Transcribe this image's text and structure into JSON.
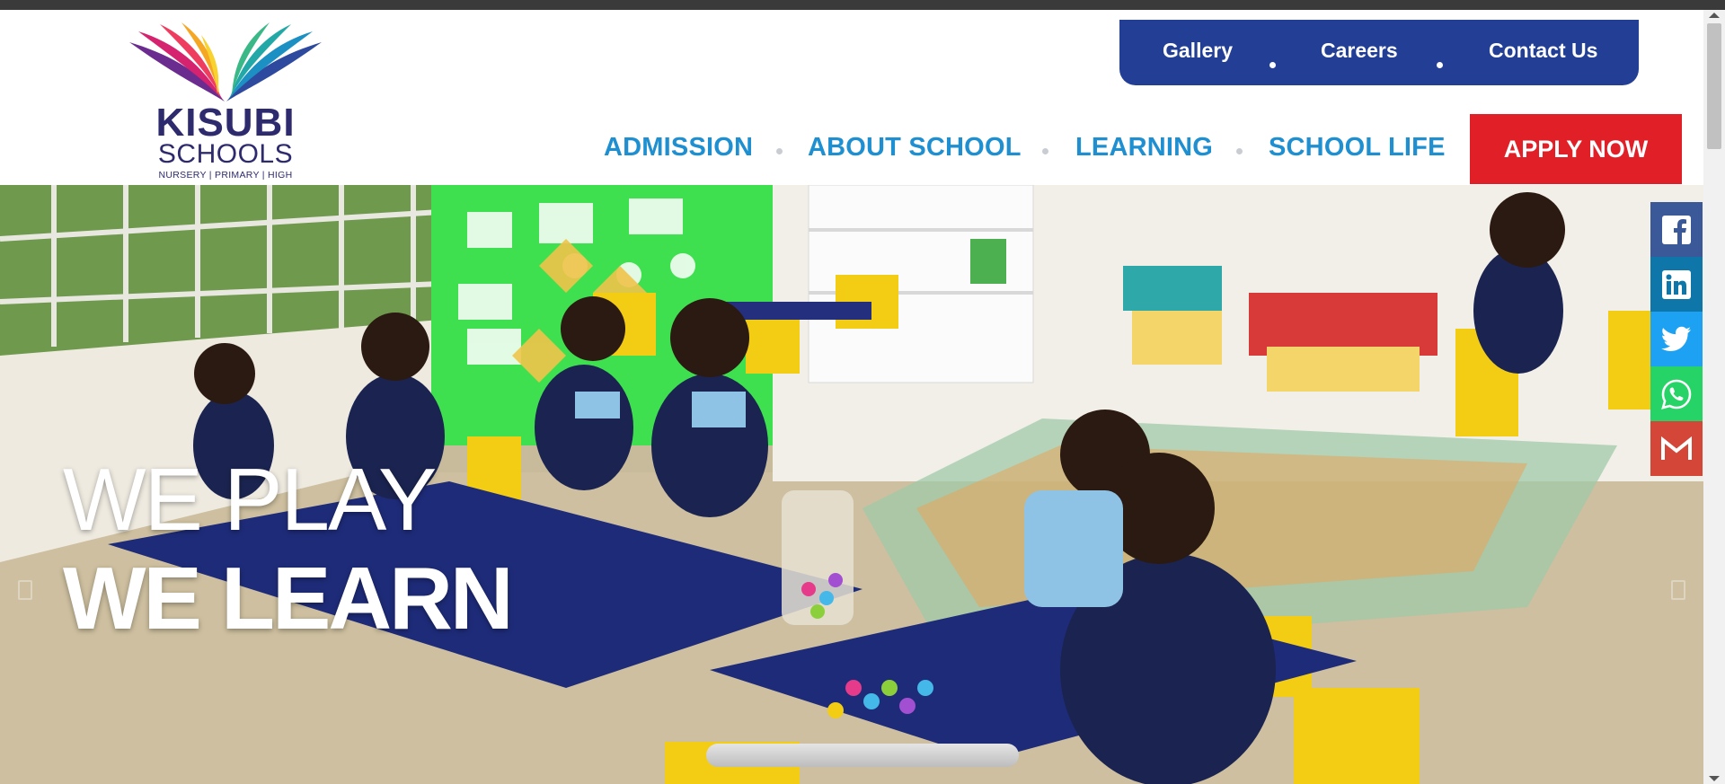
{
  "logo": {
    "line1": "KISUBI",
    "line2": "SCHOOLS",
    "line3": "NURSERY | PRIMARY | HIGH"
  },
  "top_nav": [
    {
      "label": "Gallery"
    },
    {
      "label": "Careers"
    },
    {
      "label": "Contact Us"
    }
  ],
  "main_nav": [
    {
      "label": "ADMISSION"
    },
    {
      "label": "ABOUT SCHOOL"
    },
    {
      "label": "LEARNING"
    },
    {
      "label": "SCHOOL LIFE"
    }
  ],
  "apply_label": "APPLY NOW",
  "hero": {
    "line1": "WE PLAY",
    "line2": "WE LEARN"
  },
  "social": [
    {
      "name": "facebook-icon",
      "color": "#3b5998"
    },
    {
      "name": "linkedin-icon",
      "color": "#0e76a8"
    },
    {
      "name": "twitter-icon",
      "color": "#1da1f2"
    },
    {
      "name": "whatsapp-icon",
      "color": "#25d366"
    },
    {
      "name": "gmail-icon",
      "color": "#d44638"
    }
  ],
  "colors": {
    "pill_bg": "#223f95",
    "nav_text": "#1e8fd0",
    "apply_bg": "#e01f26",
    "logo_text": "#2e2a6e"
  }
}
